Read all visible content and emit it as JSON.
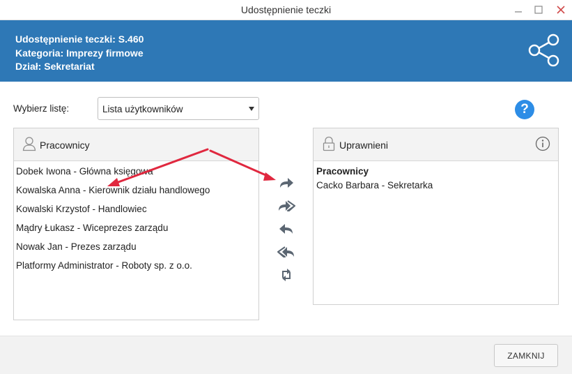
{
  "window": {
    "title": "Udostępnienie teczki"
  },
  "header": {
    "line1": "Udostępnienie teczki: S.460",
    "line2": "Kategoria: Imprezy firmowe",
    "line3": "Dział: Sekretariat",
    "background": "#2e78b6",
    "icon": "share-icon"
  },
  "selector": {
    "label": "Wybierz listę:",
    "value": "Lista użytkowników"
  },
  "left_panel": {
    "title": "Pracownicy",
    "icon": "user-icon",
    "items": [
      "Dobek Iwona - Główna księgowa",
      "Kowalska Anna - Kierownik działu handlowego",
      "Kowalski Krzystof - Handlowiec",
      "Mądry Łukasz - Wiceprezes zarządu",
      "Nowak Jan - Prezes zarządu",
      "Platformy Administrator - Roboty sp. z o.o."
    ]
  },
  "right_panel": {
    "title": "Uprawnieni",
    "icon": "lock-icon",
    "group": "Pracownicy",
    "items": [
      "Cacko Barbara - Sekretarka"
    ]
  },
  "transfer_buttons": [
    "move-right-icon",
    "move-all-right-icon",
    "move-left-icon",
    "move-all-left-icon",
    "swap-icon"
  ],
  "annotation_color": "#e0283f",
  "footer": {
    "close_label": "ZAMKNIJ"
  }
}
